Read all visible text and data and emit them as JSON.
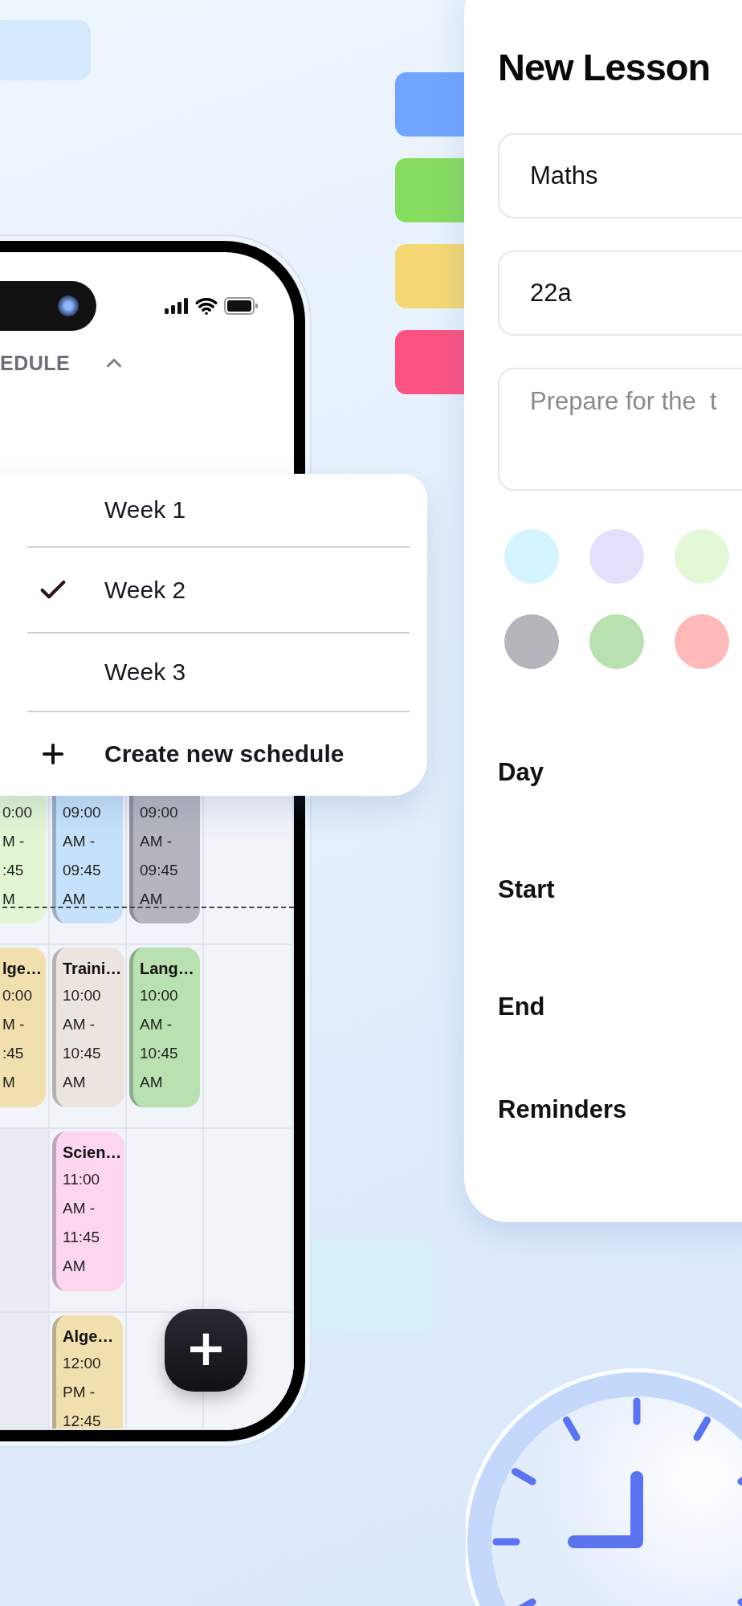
{
  "color_tabs": [
    {
      "color": "#70a4ff"
    },
    {
      "color": "#86dc5e"
    },
    {
      "color": "#f5d874"
    },
    {
      "color": "#fc5283"
    }
  ],
  "phone": {
    "header": "EDULE",
    "expanded": true,
    "schedule_menu": {
      "items": [
        {
          "label": "Week 1",
          "selected": false
        },
        {
          "label": "Week 2",
          "selected": true
        },
        {
          "label": "Week 3",
          "selected": false
        }
      ],
      "action": "Create new schedule"
    },
    "calendar": {
      "rows": [
        {
          "cells": [
            {
              "kind": "event",
              "color": "#e3f6d4",
              "times": [
                "0:00",
                "M -",
                ":45",
                "M"
              ]
            },
            {
              "kind": "event",
              "color": "#c6e1fb",
              "times": [
                "09:00",
                "AM -",
                "09:45",
                "AM"
              ]
            },
            {
              "kind": "event",
              "color": "#b3b6be",
              "times": [
                "09:00",
                "AM -",
                "09:45",
                "AM"
              ]
            },
            {
              "kind": "empty"
            }
          ]
        },
        {
          "cells": [
            {
              "kind": "event",
              "color": "#f1dfae",
              "title": "lge…",
              "times": [
                "0:00",
                "M -",
                ":45",
                "M"
              ]
            },
            {
              "kind": "event",
              "color": "#ece4df",
              "title": "Traini…",
              "times": [
                "10:00",
                "AM -",
                "10:45",
                "AM"
              ]
            },
            {
              "kind": "event",
              "color": "#b8e0b0",
              "title": "Lang…",
              "times": [
                "10:00",
                "AM -",
                "10:45",
                "AM"
              ]
            },
            {
              "kind": "empty"
            }
          ]
        },
        {
          "cells": [
            {
              "kind": "empty"
            },
            {
              "kind": "event",
              "color": "#fdd5ef",
              "title": "Scien…",
              "times": [
                "11:00",
                "AM -",
                "11:45",
                "AM"
              ]
            },
            {
              "kind": "empty"
            },
            {
              "kind": "empty"
            }
          ]
        },
        {
          "cells": [
            {
              "kind": "empty"
            },
            {
              "kind": "event",
              "color": "#f1dfae",
              "title": "Alge…",
              "times": [
                "12:00",
                "PM -",
                "12:45"
              ]
            },
            {
              "kind": "empty"
            },
            {
              "kind": "empty"
            }
          ]
        }
      ]
    },
    "fab": "+"
  },
  "lesson_form": {
    "title": "New Lesson",
    "fields": [
      {
        "kind": "input",
        "value": "Maths"
      },
      {
        "kind": "input",
        "value": "22a"
      },
      {
        "kind": "textarea",
        "placeholder": "Prepare for the  t"
      }
    ],
    "colors": [
      {
        "color": "#d4f5fd"
      },
      {
        "color": "#e4e0fb"
      },
      {
        "color": "#e3f8d6"
      },
      {
        "color": "#b4b6bb"
      },
      {
        "color": "#b8e0b0"
      },
      {
        "color": "#feb9b9"
      }
    ],
    "labels": [
      "Day",
      "Start",
      "End",
      "Reminders"
    ]
  }
}
